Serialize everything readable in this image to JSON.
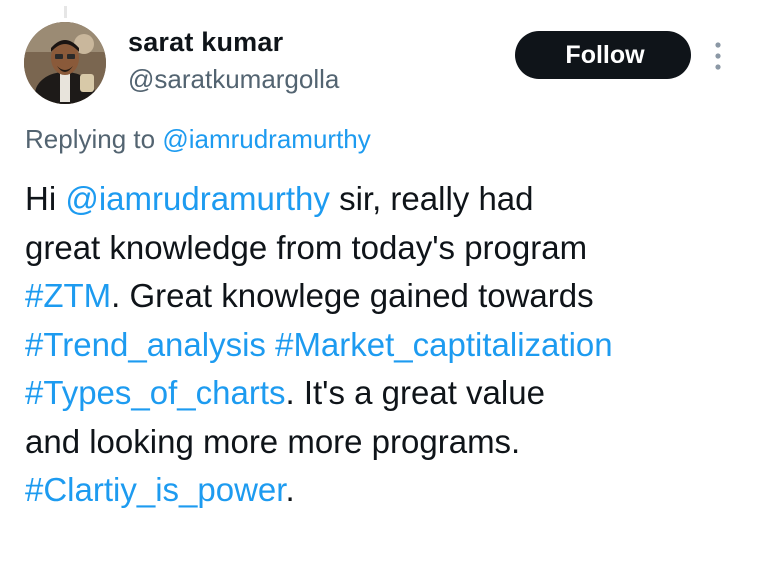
{
  "user": {
    "display_name": "sarat kumar",
    "handle": "@saratkumargolla",
    "avatar_icon": "profile-photo"
  },
  "actions": {
    "follow_label": "Follow",
    "more_icon": "vertical-ellipsis-icon"
  },
  "reply": {
    "prefix": "Replying to ",
    "mention": "@iamrudramurthy"
  },
  "tweet": {
    "lines": [
      [
        {
          "text": "Hi ",
          "link": false
        },
        {
          "text": "@iamrudramurthy",
          "link": true
        },
        {
          "text": "  sir, really had",
          "link": false
        }
      ],
      [
        {
          "text": "great knowledge from today's program",
          "link": false
        }
      ],
      [
        {
          "text": "#ZTM",
          "link": true
        },
        {
          "text": ". Great knowlege gained towards",
          "link": false
        }
      ],
      [
        {
          "text": "#Trend_analysis",
          "link": true
        },
        {
          "text": " ",
          "link": false
        },
        {
          "text": "#Market_captitalization",
          "link": true
        }
      ],
      [
        {
          "text": "#Types_of_charts",
          "link": true
        },
        {
          "text": ". It's a great value",
          "link": false
        }
      ],
      [
        {
          "text": "and looking  more more programs.",
          "link": false
        }
      ],
      [
        {
          "text": "#Clartiy_is_power",
          "link": true
        },
        {
          "text": ".",
          "link": false
        }
      ]
    ]
  },
  "colors": {
    "link": "#1d9bf0",
    "text": "#0f1419",
    "secondary": "#536471",
    "button_bg": "#0f1419"
  }
}
